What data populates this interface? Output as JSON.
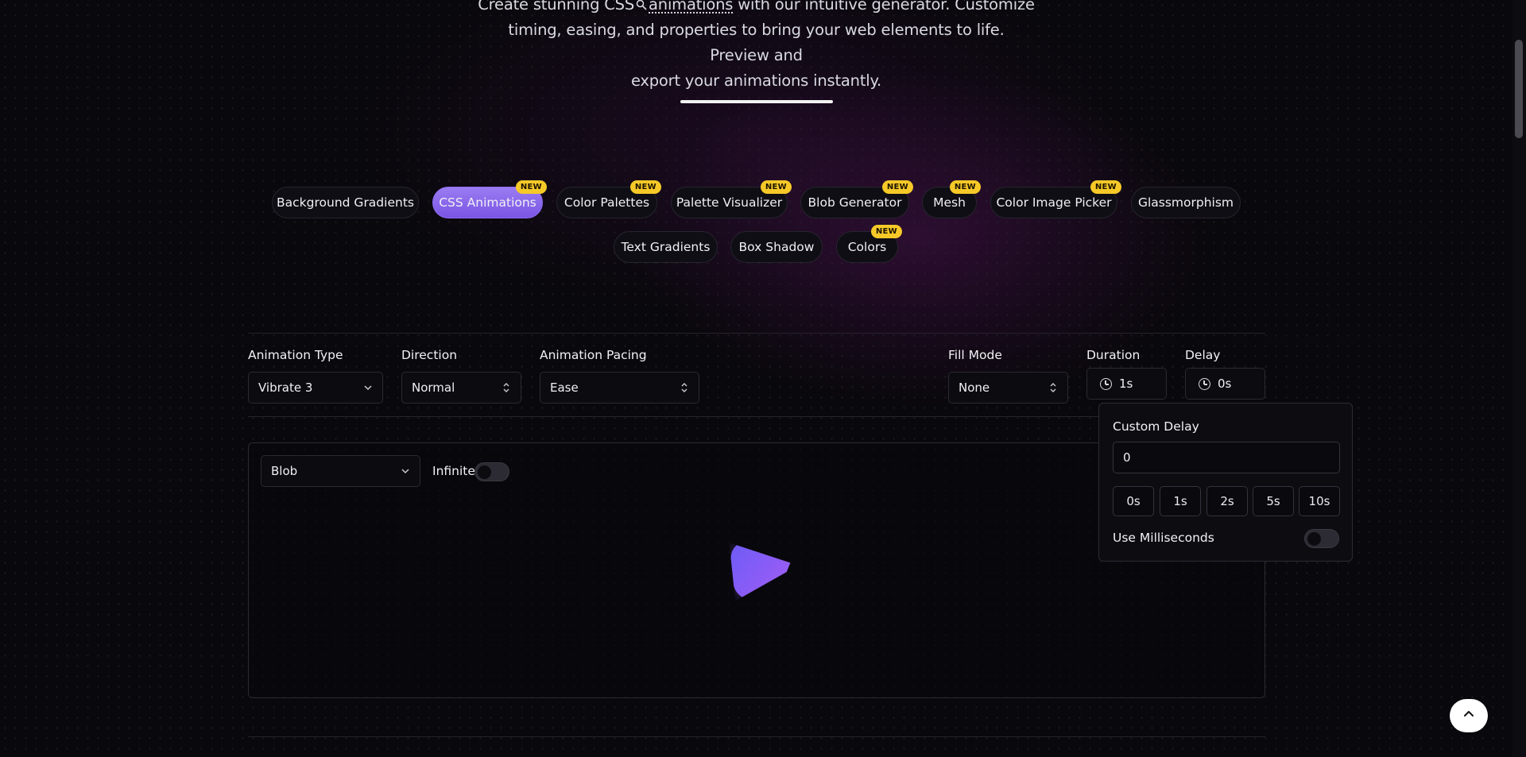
{
  "hero": {
    "line1_a": "Create stunning CSS",
    "line1_hl": "animations",
    "line1_b": "with our intuitive generator. Customize",
    "line2": "timing, easing, and properties to bring your web elements to life. Preview and",
    "line3": "export your animations instantly."
  },
  "tools": [
    {
      "label": "Background Gradients",
      "badge": ""
    },
    {
      "label": "CSS Animations",
      "badge": "NEW",
      "active": true
    },
    {
      "label": "Color Palettes",
      "badge": "NEW"
    },
    {
      "label": "Palette Visualizer",
      "badge": "NEW"
    },
    {
      "label": "Blob Generator",
      "badge": "NEW"
    },
    {
      "label": "Mesh",
      "badge": "NEW"
    },
    {
      "label": "Color Image Picker",
      "badge": "NEW"
    },
    {
      "label": "Glassmorphism",
      "badge": ""
    },
    {
      "label": "Text Gradients",
      "badge": ""
    },
    {
      "label": "Box Shadow",
      "badge": ""
    },
    {
      "label": "Colors",
      "badge": "NEW"
    }
  ],
  "controls": {
    "animation_type": {
      "label": "Animation Type",
      "value": "Vibrate 3"
    },
    "direction": {
      "label": "Direction",
      "value": "Normal"
    },
    "pacing": {
      "label": "Animation Pacing",
      "value": "Ease"
    },
    "fill_mode": {
      "label": "Fill Mode",
      "value": "None"
    },
    "duration": {
      "label": "Duration",
      "value": "1s"
    },
    "delay": {
      "label": "Delay",
      "value": "0s"
    }
  },
  "preview": {
    "shape": "Blob",
    "infinite_label": "Infinite",
    "infinite_on": false
  },
  "custom_delay": {
    "title": "Custom Delay",
    "value": "0",
    "presets": [
      "0s",
      "1s",
      "2s",
      "5s",
      "10s"
    ],
    "ms_label": "Use Milliseconds",
    "ms_on": false
  },
  "colors": {
    "accent": "#8b5cf6",
    "badge": "#f6c928",
    "background": "#09080c"
  },
  "icons": {
    "chevron_down": "chevron-down-icon",
    "updown": "chevron-up-down-icon",
    "clock": "clock-icon",
    "search": "search-icon",
    "scroll_top": "chevron-up-icon"
  }
}
